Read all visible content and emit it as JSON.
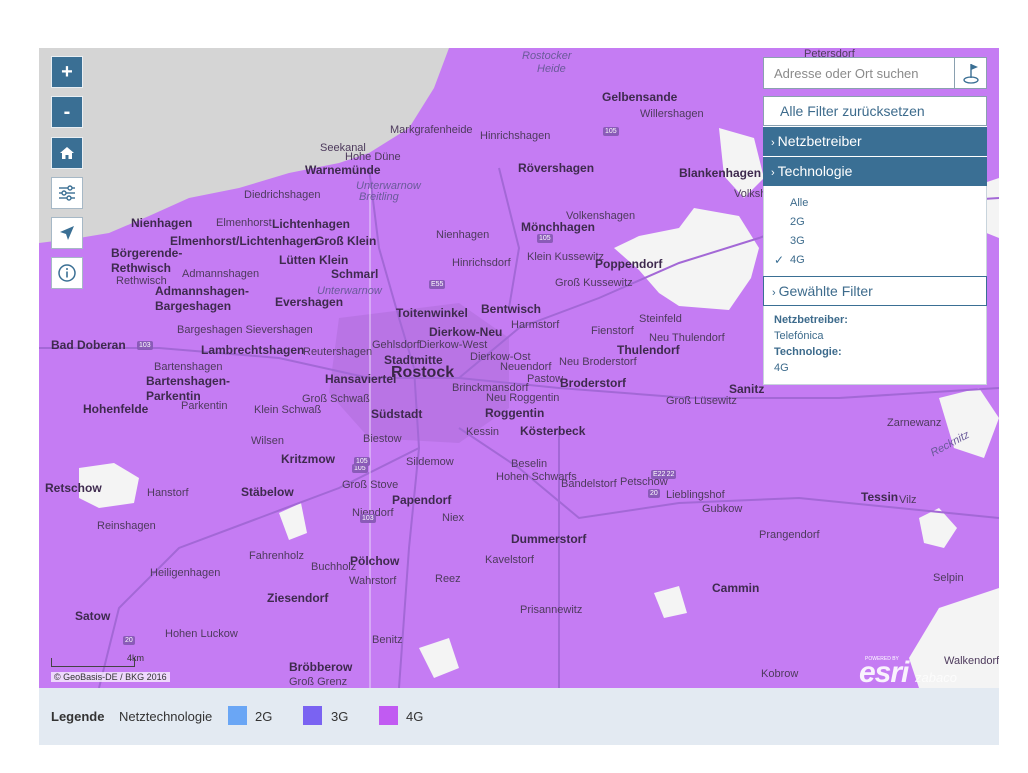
{
  "map": {
    "colors": {
      "coverage": "#c57cf3",
      "sea": "#d5d5d5",
      "gap": "#f4f4f4",
      "road": "#a368d6"
    },
    "places": [
      {
        "name": "Rostocker",
        "cls": "water"
      },
      {
        "name": "Heide",
        "cls": "water"
      },
      {
        "name": "Gelbensande",
        "cls": "big"
      },
      {
        "name": "Willershagen",
        "cls": ""
      },
      {
        "name": "Markgrafenheide",
        "cls": ""
      },
      {
        "name": "Hinrichshagen",
        "cls": ""
      },
      {
        "name": "Seekanal",
        "cls": ""
      },
      {
        "name": "Hohe Düne",
        "cls": ""
      },
      {
        "name": "Warnemünde",
        "cls": "big"
      },
      {
        "name": "Rövershagen",
        "cls": "big"
      },
      {
        "name": "Blankenhagen",
        "cls": "big"
      },
      {
        "name": "Unterwarnow",
        "cls": "water"
      },
      {
        "name": "Breitling",
        "cls": "water"
      },
      {
        "name": "Diedrichshagen",
        "cls": ""
      },
      {
        "name": "Nienhagen",
        "cls": "big"
      },
      {
        "name": "Elmenhorst",
        "cls": ""
      },
      {
        "name": "Lichtenhagen",
        "cls": "big"
      },
      {
        "name": "Mönchhagen",
        "cls": "big"
      },
      {
        "name": "Volkenshagen",
        "cls": ""
      },
      {
        "name": "Börgerende-",
        "cls": "big"
      },
      {
        "name": "Rethwisch",
        "cls": "big"
      },
      {
        "name": "Elmenhorst/Lichtenhagen",
        "cls": "big"
      },
      {
        "name": "Groß Klein",
        "cls": "big"
      },
      {
        "name": "Lütten Klein",
        "cls": "big"
      },
      {
        "name": "Schmarl",
        "cls": "big"
      },
      {
        "name": "Nienhagen",
        "cls": ""
      },
      {
        "name": "Hinrichsdorf",
        "cls": ""
      },
      {
        "name": "Klein Kussewitz",
        "cls": ""
      },
      {
        "name": "Poppendorf",
        "cls": "big"
      },
      {
        "name": "Rethwisch",
        "cls": ""
      },
      {
        "name": "Admannshagen",
        "cls": ""
      },
      {
        "name": "Admannshagen-",
        "cls": "big"
      },
      {
        "name": "Bargeshagen",
        "cls": "big"
      },
      {
        "name": "Evershagen",
        "cls": "big"
      },
      {
        "name": "Unterwarnow",
        "cls": "water"
      },
      {
        "name": "Toitenwinkel",
        "cls": "big"
      },
      {
        "name": "Bentwisch",
        "cls": "big"
      },
      {
        "name": "Groß Kussewitz",
        "cls": ""
      },
      {
        "name": "Steinfeld",
        "cls": ""
      },
      {
        "name": "Bargeshagen Sievershagen",
        "cls": ""
      },
      {
        "name": "Dierkow-Neu",
        "cls": "big"
      },
      {
        "name": "Harmstorf",
        "cls": ""
      },
      {
        "name": "Fienstorf",
        "cls": ""
      },
      {
        "name": "Neu Thulendorf",
        "cls": ""
      },
      {
        "name": "Bad Doberan",
        "cls": "big"
      },
      {
        "name": "Lambrechtshagen",
        "cls": "big"
      },
      {
        "name": "Reutershagen",
        "cls": ""
      },
      {
        "name": "Gehlsdorf",
        "cls": ""
      },
      {
        "name": "Dierkow-West",
        "cls": ""
      },
      {
        "name": "Thulendorf",
        "cls": "big"
      },
      {
        "name": "Stadtmitte",
        "cls": "big"
      },
      {
        "name": "Dierkow-Ost",
        "cls": ""
      },
      {
        "name": "Neu Broderstorf",
        "cls": ""
      },
      {
        "name": "Bartenshagen",
        "cls": ""
      },
      {
        "name": "Bartenshagen-",
        "cls": "big"
      },
      {
        "name": "Parkentin",
        "cls": "big"
      },
      {
        "name": "Hansaviertel",
        "cls": "big"
      },
      {
        "name": "Rostock",
        "cls": "city"
      },
      {
        "name": "Neuendorf",
        "cls": ""
      },
      {
        "name": "Pastow",
        "cls": ""
      },
      {
        "name": "Broderstorf",
        "cls": "big"
      },
      {
        "name": "Sanitz",
        "cls": "big"
      },
      {
        "name": "Brinckmansdorf",
        "cls": ""
      },
      {
        "name": "Parkentin",
        "cls": ""
      },
      {
        "name": "Groß Schwaß",
        "cls": ""
      },
      {
        "name": "Neu Roggentin",
        "cls": ""
      },
      {
        "name": "Groß Lüsewitz",
        "cls": ""
      },
      {
        "name": "Hohenfelde",
        "cls": "big"
      },
      {
        "name": "Klein Schwaß",
        "cls": ""
      },
      {
        "name": "Südstadt",
        "cls": "big"
      },
      {
        "name": "Roggentin",
        "cls": "big"
      },
      {
        "name": "Kessin",
        "cls": ""
      },
      {
        "name": "Kösterbeck",
        "cls": "big"
      },
      {
        "name": "Zarnewanz",
        "cls": ""
      },
      {
        "name": "Wilsen",
        "cls": ""
      },
      {
        "name": "Biestow",
        "cls": ""
      },
      {
        "name": "Kritzmow",
        "cls": "big"
      },
      {
        "name": "Sildemow",
        "cls": ""
      },
      {
        "name": "Beselin",
        "cls": ""
      },
      {
        "name": "Hohen Schwarfs",
        "cls": ""
      },
      {
        "name": "Bandelstorf",
        "cls": ""
      },
      {
        "name": "Petschow",
        "cls": ""
      },
      {
        "name": "Retschow",
        "cls": "big"
      },
      {
        "name": "Hanstorf",
        "cls": ""
      },
      {
        "name": "Stäbelow",
        "cls": "big"
      },
      {
        "name": "Groß Stove",
        "cls": ""
      },
      {
        "name": "Papendorf",
        "cls": "big"
      },
      {
        "name": "Lieblingshof",
        "cls": ""
      },
      {
        "name": "Tessin",
        "cls": "big"
      },
      {
        "name": "Vilz",
        "cls": ""
      },
      {
        "name": "Gubkow",
        "cls": ""
      },
      {
        "name": "Reinshagen",
        "cls": ""
      },
      {
        "name": "Niendorf",
        "cls": ""
      },
      {
        "name": "Niex",
        "cls": ""
      },
      {
        "name": "Dummerstorf",
        "cls": "big"
      },
      {
        "name": "Prangendorf",
        "cls": ""
      },
      {
        "name": "Fahrenholz",
        "cls": ""
      },
      {
        "name": "Pölchow",
        "cls": "big"
      },
      {
        "name": "Kavelstorf",
        "cls": ""
      },
      {
        "name": "Heiligenhagen",
        "cls": ""
      },
      {
        "name": "Buchholz",
        "cls": ""
      },
      {
        "name": "Wahrstorf",
        "cls": ""
      },
      {
        "name": "Reez",
        "cls": ""
      },
      {
        "name": "Cammin",
        "cls": "big"
      },
      {
        "name": "Selpin",
        "cls": ""
      },
      {
        "name": "Ziesendorf",
        "cls": "big"
      },
      {
        "name": "Prisannewitz",
        "cls": ""
      },
      {
        "name": "Satow",
        "cls": "big"
      },
      {
        "name": "Hohen Luckow",
        "cls": ""
      },
      {
        "name": "Benitz",
        "cls": ""
      },
      {
        "name": "Bröbberow",
        "cls": "big"
      },
      {
        "name": "Groß Grenz",
        "cls": ""
      },
      {
        "name": "Kobrow",
        "cls": ""
      },
      {
        "name": "Walkendorf",
        "cls": ""
      },
      {
        "name": "Recknitz",
        "cls": "water"
      },
      {
        "name": "Petersdorf",
        "cls": ""
      },
      {
        "name": "Volkshagen",
        "cls": ""
      }
    ],
    "roads": [
      "105",
      "105",
      "103",
      "105",
      "105",
      "E55",
      "E22",
      "20",
      "103",
      "E22",
      "20"
    ]
  },
  "controls": {
    "zoom_in": "+",
    "zoom_out": "-"
  },
  "search": {
    "placeholder": "Adresse oder Ort suchen"
  },
  "filters": {
    "reset_label": "Alle Filter zurücksetzen",
    "operator_header": "Netzbetreiber",
    "technology_header": "Technologie",
    "technology_options": [
      {
        "label": "Alle",
        "checked": false
      },
      {
        "label": "2G",
        "checked": false
      },
      {
        "label": "3G",
        "checked": false
      },
      {
        "label": "4G",
        "checked": true
      }
    ],
    "chosen_header": "Gewählte Filter",
    "chosen": {
      "operator_label": "Netzbetreiber:",
      "operator_value": "Telefónica",
      "technology_label": "Technologie:",
      "technology_value": "4G"
    }
  },
  "attribution": "© GeoBasis-DE / BKG 2016",
  "scale_label": "4km",
  "esri": {
    "powered": "POWERED BY",
    "logo": "esri",
    "partner": "zabaco"
  },
  "legend": {
    "title": "Legende",
    "subtitle": "Netztechnologie",
    "items": [
      {
        "label": "2G",
        "color": "#6aa6f5"
      },
      {
        "label": "3G",
        "color": "#7a63f2"
      },
      {
        "label": "4G",
        "color": "#c15bf2"
      }
    ]
  }
}
